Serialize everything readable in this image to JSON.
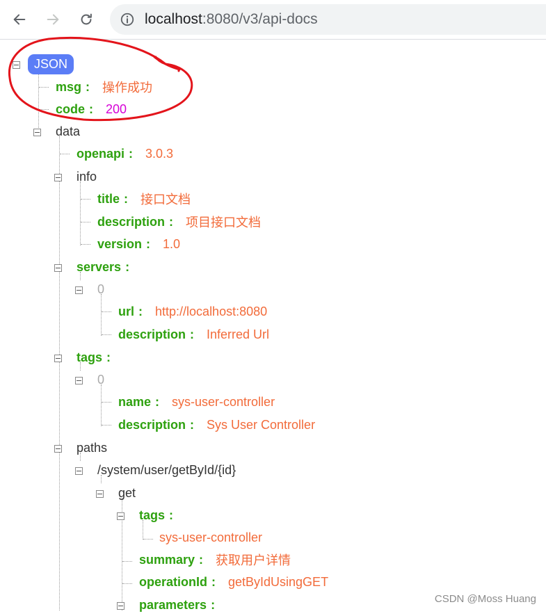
{
  "browser": {
    "url_host": "localhost",
    "url_rest": ":8080/v3/api-docs",
    "icons": [
      "back-arrow-icon",
      "forward-arrow-icon",
      "reload-icon",
      "site-info-icon"
    ]
  },
  "tree": {
    "root_label": "JSON",
    "msg_key": "msg",
    "msg_val": "操作成功",
    "code_key": "code",
    "code_val": "200",
    "data_key": "data",
    "openapi_key": "openapi",
    "openapi_val": "3.0.3",
    "info_key": "info",
    "title_key": "title",
    "title_val": "接口文档",
    "info_desc_key": "description",
    "info_desc_val": "项目接口文档",
    "version_key": "version",
    "version_val": "1.0",
    "servers_key": "servers",
    "servers_idx": "0",
    "url_key": "url",
    "url_val": "http://localhost:8080",
    "srv_desc_key": "description",
    "srv_desc_val": "Inferred Url",
    "tags_key": "tags",
    "tags_idx": "0",
    "name_key": "name",
    "name_val": "sys-user-controller",
    "tag_desc_key": "description",
    "tag_desc_val": "Sys User Controller",
    "paths_key": "paths",
    "path_key": "/system/user/getById/{id}",
    "get_key": "get",
    "get_tags_key": "tags",
    "get_tags_item": "sys-user-controller",
    "summary_key": "summary",
    "summary_val": "获取用户详情",
    "opid_key": "operationId",
    "opid_val": "getByIdUsingGET",
    "params_key": "parameters",
    "colon": ":"
  },
  "watermark": "CSDN @Moss Huang",
  "colors": {
    "key": "#2ea10f",
    "string": "#f26b3a",
    "number": "#d600d6",
    "badge": "#5b7df6",
    "annotation": "#e3141b"
  }
}
